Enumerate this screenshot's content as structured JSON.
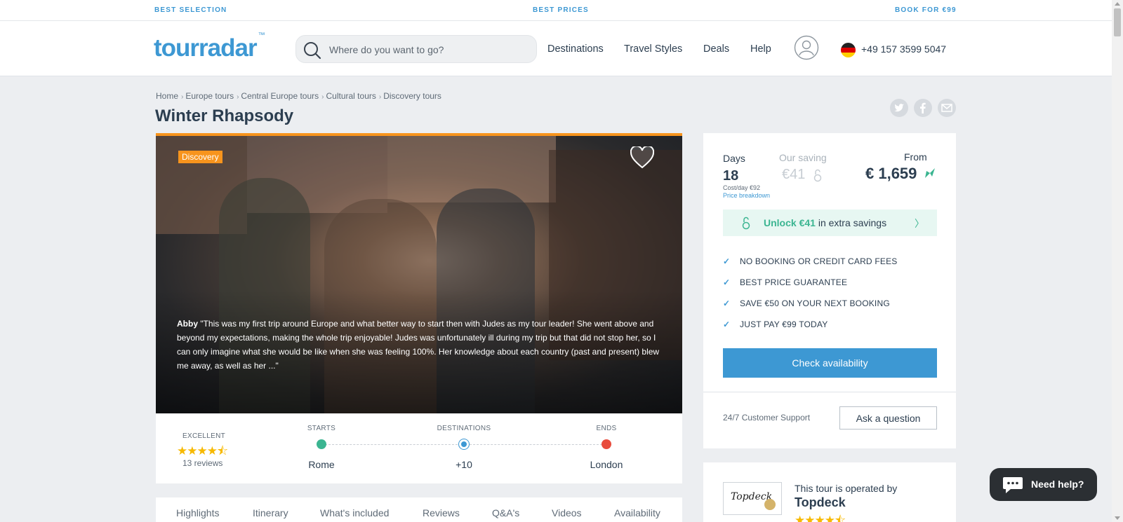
{
  "topstrip": {
    "left": "BEST SELECTION",
    "center": "BEST PRICES",
    "right": "BOOK FOR €99"
  },
  "header": {
    "logo": "tourradar",
    "logo_tm": "™",
    "search_placeholder": "Where do you want to go?",
    "nav": [
      "Destinations",
      "Travel Styles",
      "Deals",
      "Help"
    ],
    "phone": "+49 157 3599 5047"
  },
  "breadcrumb": [
    "Home",
    "Europe tours",
    "Central Europe tours",
    "Cultural tours",
    "Discovery tours"
  ],
  "breadcrumb_sep": "›",
  "title": "Winter Rhapsody",
  "hero": {
    "badge": "Discovery",
    "review_author": "Abby",
    "review_text": " \"This was my first trip around Europe and what better way to start then with Judes as my tour leader! She went above and beyond my expectations, making the whole trip enjoyable! Judes was unfortunately ill during my trip but that did not stop her, so I can only imagine what she would be like when she was feeling 100%. Her knowledge about each country (past and present) blew me away, as well as her ...\""
  },
  "meta": {
    "rating_label": "EXCELLENT",
    "stars": "★★★★⯪",
    "rating_value": 4.5,
    "reviews": "13 reviews",
    "starts_label": "STARTS",
    "starts": "Rome",
    "destinations_label": "DESTINATIONS",
    "destinations": "+10",
    "ends_label": "ENDS",
    "ends": "London"
  },
  "tabs": [
    "Highlights",
    "Itinerary",
    "What's included",
    "Reviews",
    "Q&A's",
    "Videos",
    "Availability"
  ],
  "booking": {
    "days_label": "Days",
    "days": "18",
    "cost_per_day": "Cost/day €92",
    "price_breakdown": "Price breakdown",
    "saving_label": "Our saving",
    "saving": "€41",
    "from_label": "From",
    "price": "€ 1,659",
    "unlock_prefix": "Unlock €41",
    "unlock_suffix": " in extra savings",
    "unlock_chevron": "〉",
    "perks": [
      "NO BOOKING OR CREDIT CARD FEES",
      "BEST PRICE GUARANTEE",
      "SAVE €50 ON YOUR NEXT BOOKING",
      "JUST PAY €99 TODAY"
    ],
    "cta": "Check availability",
    "support": "24/7 Customer Support",
    "ask": "Ask a question"
  },
  "operator": {
    "logo_text": "Topdeck",
    "intro": "This tour is operated by",
    "name": "Topdeck",
    "stars": "★★★★⯪"
  },
  "help_button": "Need help?",
  "colors": {
    "brand": "#3d98d3",
    "accent": "#f7941d",
    "green": "#3bb591",
    "star": "#f7b900"
  }
}
